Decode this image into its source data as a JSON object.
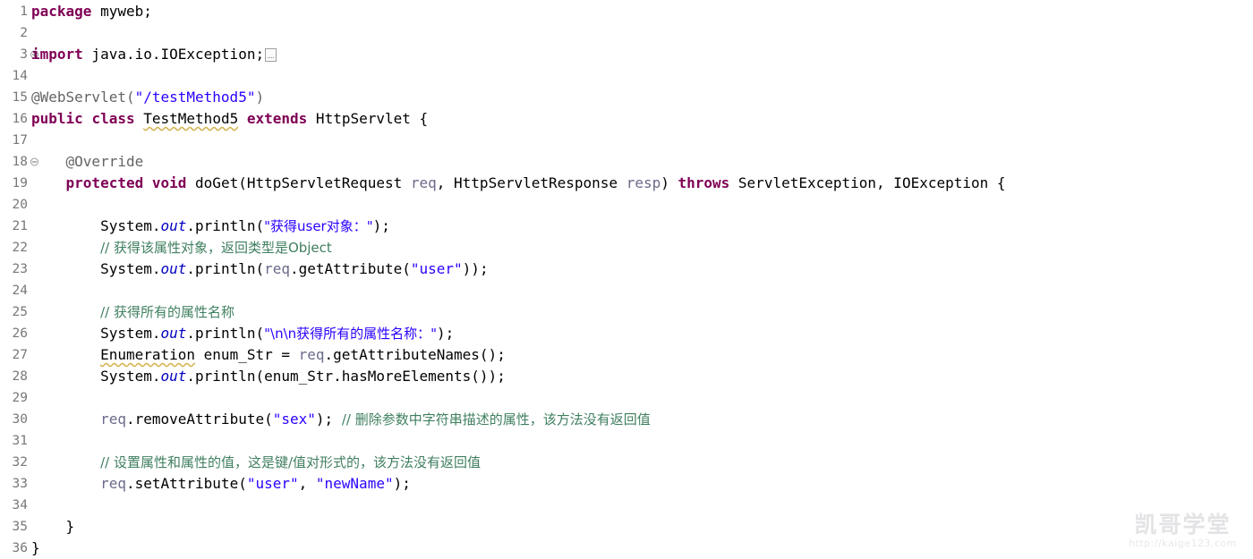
{
  "editor": {
    "language": "java",
    "colors": {
      "background": "#ffffff",
      "keyword": "#7f0055",
      "string": "#2a00ff",
      "comment": "#3f7f5f",
      "annotation": "#646464",
      "field_static": "#0000c0",
      "parameter": "#6a6a8a",
      "line_number": "#787878",
      "warning_squiggle": "#d6b656"
    },
    "gutter": [
      {
        "number": "1",
        "fold": "none"
      },
      {
        "number": "2",
        "fold": "none"
      },
      {
        "number": "3",
        "fold": "collapsed"
      },
      {
        "number": "14",
        "fold": "none"
      },
      {
        "number": "15",
        "fold": "none"
      },
      {
        "number": "16",
        "fold": "none"
      },
      {
        "number": "17",
        "fold": "none"
      },
      {
        "number": "18",
        "fold": "expanded"
      },
      {
        "number": "19",
        "fold": "none"
      },
      {
        "number": "20",
        "fold": "none"
      },
      {
        "number": "21",
        "fold": "none"
      },
      {
        "number": "22",
        "fold": "none"
      },
      {
        "number": "23",
        "fold": "none"
      },
      {
        "number": "24",
        "fold": "none"
      },
      {
        "number": "25",
        "fold": "none"
      },
      {
        "number": "26",
        "fold": "none"
      },
      {
        "number": "27",
        "fold": "none"
      },
      {
        "number": "28",
        "fold": "none"
      },
      {
        "number": "29",
        "fold": "none"
      },
      {
        "number": "30",
        "fold": "none"
      },
      {
        "number": "31",
        "fold": "none"
      },
      {
        "number": "32",
        "fold": "none"
      },
      {
        "number": "33",
        "fold": "none"
      },
      {
        "number": "34",
        "fold": "none"
      },
      {
        "number": "35",
        "fold": "none"
      },
      {
        "number": "36",
        "fold": "none"
      }
    ],
    "lines": [
      {
        "n": "1",
        "text": "package myweb;"
      },
      {
        "n": "2",
        "text": ""
      },
      {
        "n": "3",
        "text": "import java.io.IOException;"
      },
      {
        "n": "14",
        "text": ""
      },
      {
        "n": "15",
        "text": "@WebServlet(\"/testMethod5\")"
      },
      {
        "n": "16",
        "text": "public class TestMethod5 extends HttpServlet {"
      },
      {
        "n": "17",
        "text": ""
      },
      {
        "n": "18",
        "text": "    @Override"
      },
      {
        "n": "19",
        "text": "    protected void doGet(HttpServletRequest req, HttpServletResponse resp) throws ServletException, IOException {"
      },
      {
        "n": "20",
        "text": ""
      },
      {
        "n": "21",
        "text": "        System.out.println(\"获得user对象：\");"
      },
      {
        "n": "22",
        "text": "        // 获得该属性对象，返回类型是Object"
      },
      {
        "n": "23",
        "text": "        System.out.println(req.getAttribute(\"user\"));"
      },
      {
        "n": "24",
        "text": ""
      },
      {
        "n": "25",
        "text": "        // 获得所有的属性名称"
      },
      {
        "n": "26",
        "text": "        System.out.println(\"\\n\\n获得所有的属性名称：\");"
      },
      {
        "n": "27",
        "text": "        Enumeration enum_Str = req.getAttributeNames();"
      },
      {
        "n": "28",
        "text": "        System.out.println(enum_Str.hasMoreElements());"
      },
      {
        "n": "29",
        "text": ""
      },
      {
        "n": "30",
        "text": "        req.removeAttribute(\"sex\"); // 删除参数中字符串描述的属性，该方法没有返回值"
      },
      {
        "n": "31",
        "text": ""
      },
      {
        "n": "32",
        "text": "        // 设置属性和属性的值，这是键/值对形式的，该方法没有返回值"
      },
      {
        "n": "33",
        "text": "        req.setAttribute(\"user\", \"newName\");"
      },
      {
        "n": "34",
        "text": ""
      },
      {
        "n": "35",
        "text": "    }"
      },
      {
        "n": "36",
        "text": "}"
      }
    ],
    "tokens": {
      "l1_kw_package": "package",
      "l1_rest": " myweb;",
      "l3_kw_import": "import",
      "l3_rest": " java.io.IOException;",
      "l15_annotation": "@WebServlet(",
      "l15_string": "\"/testMethod5\"",
      "l15_close": ")",
      "l16_public": "public",
      "l16_sp1": " ",
      "l16_class": "class",
      "l16_sp2": " ",
      "l16_typename": "TestMethod5",
      "l16_sp3": " ",
      "l16_extends": "extends",
      "l16_rest": " HttpServlet {",
      "l18_indent": "    ",
      "l18_override": "@Override",
      "l19_indent": "    ",
      "l19_protected": "protected",
      "l19_sp1": " ",
      "l19_void": "void",
      "l19_mid1": " doGet(HttpServletRequest ",
      "l19_param1": "req",
      "l19_mid2": ", HttpServletResponse ",
      "l19_param2": "resp",
      "l19_close": ") ",
      "l19_throws": "throws",
      "l19_tail": " ServletException, IOException {",
      "l21_indent": "        ",
      "l21_system": "System.",
      "l21_out": "out",
      "l21_println": ".println(",
      "l21_string": "\"获得user对象：\"",
      "l21_tail": ");",
      "l22_indent": "        ",
      "l22_comment": "// 获得该属性对象，返回类型是Object",
      "l23_indent": "        ",
      "l23_system": "System.",
      "l23_out": "out",
      "l23_println": ".println(",
      "l23_req": "req",
      "l23_getattr": ".getAttribute(",
      "l23_string": "\"user\"",
      "l23_tail": "));",
      "l25_indent": "        ",
      "l25_comment": "// 获得所有的属性名称",
      "l26_indent": "        ",
      "l26_system": "System.",
      "l26_out": "out",
      "l26_println": ".println(",
      "l26_string": "\"\\n\\n获得所有的属性名称：\"",
      "l26_tail": ");",
      "l27_indent": "        ",
      "l27_type": "Enumeration",
      "l27_var": " enum_Str = ",
      "l27_req": "req",
      "l27_tail": ".getAttributeNames();",
      "l28_indent": "        ",
      "l28_system": "System.",
      "l28_out": "out",
      "l28_tail": ".println(enum_Str.hasMoreElements());",
      "l30_indent": "        ",
      "l30_req": "req",
      "l30_call": ".removeAttribute(",
      "l30_string": "\"sex\"",
      "l30_semi": "); ",
      "l30_comment": "// 删除参数中字符串描述的属性，该方法没有返回值",
      "l32_indent": "        ",
      "l32_comment": "// 设置属性和属性的值，这是键/值对形式的，该方法没有返回值",
      "l33_indent": "        ",
      "l33_req": "req",
      "l33_call": ".setAttribute(",
      "l33_string1": "\"user\"",
      "l33_comma": ", ",
      "l33_string2": "\"newName\"",
      "l33_tail": ");",
      "l35_indent": "    ",
      "l35_brace": "}",
      "l36_brace": "}"
    }
  },
  "watermark": {
    "title": "凯哥学堂",
    "url": "http://kaige123.com"
  }
}
